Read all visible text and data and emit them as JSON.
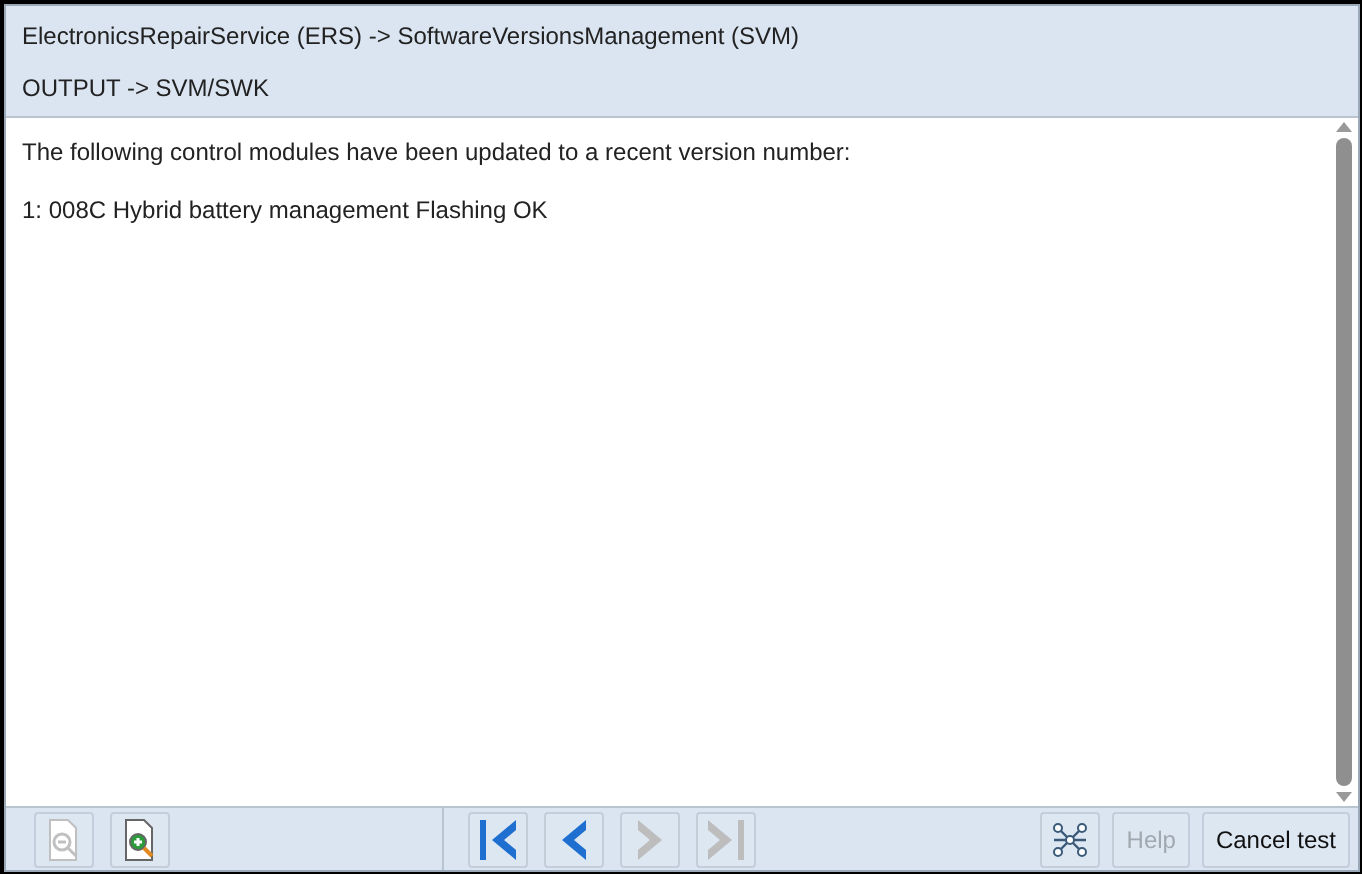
{
  "header": {
    "title": "ElectronicsRepairService (ERS) -> SoftwareVersionsManagement (SVM)",
    "subtitle": "OUTPUT -> SVM/SWK"
  },
  "content": {
    "lines": [
      "The following control modules have been updated to a recent version number:",
      "1: 008C Hybrid battery management Flashing OK"
    ]
  },
  "toolbar": {
    "left": [
      {
        "kind": "zoom-out",
        "disabled": true
      },
      {
        "kind": "zoom-in",
        "disabled": false
      }
    ],
    "nav": [
      {
        "kind": "first",
        "disabled": false
      },
      {
        "kind": "prev",
        "disabled": false
      },
      {
        "kind": "next",
        "disabled": true
      },
      {
        "kind": "last",
        "disabled": true
      }
    ],
    "right": [
      {
        "kind": "network",
        "disabled": false
      },
      {
        "kind": "text",
        "label": "Help",
        "disabled": true
      },
      {
        "kind": "text",
        "label": "Cancel test",
        "disabled": false
      }
    ]
  }
}
